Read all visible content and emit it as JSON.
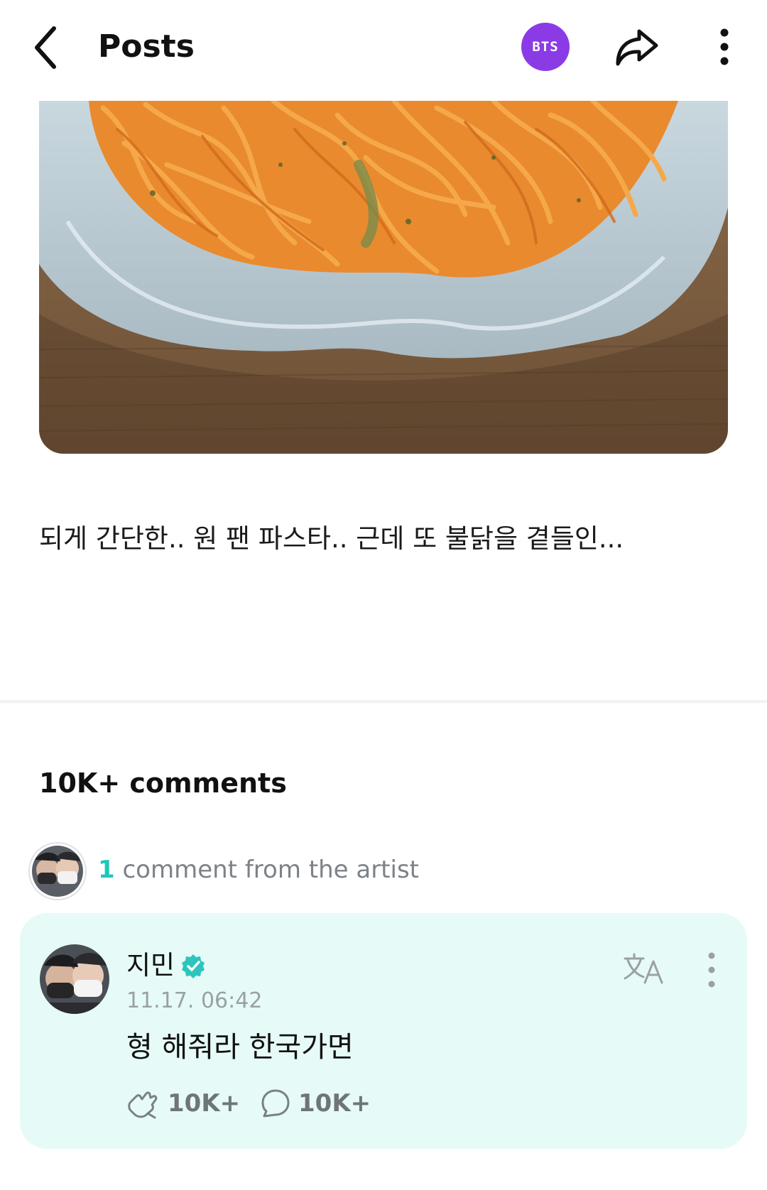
{
  "header": {
    "title": "Posts",
    "community_badge": "BTS",
    "accent": "#8b3be6",
    "icons": {
      "back": "chevron-left-icon",
      "share": "share-arrow-icon",
      "more": "kebab-vertical-icon"
    }
  },
  "post": {
    "image": "pasta-photo",
    "text": "되게 간단한.. 원 팬 파스타.. 근데 또 불닭을 곁들인..."
  },
  "comments": {
    "count_label": "10K+ comments",
    "artist_summary": {
      "count": "1",
      "label": "comment from the artist"
    },
    "featured": {
      "author": "지민",
      "verified": true,
      "timestamp": "11.17. 06:42",
      "body": "형 해줘라 한국가면",
      "likes": "10K+",
      "replies": "10K+",
      "card_color": "#e6fbf7",
      "accent": "#1ec7be"
    }
  }
}
